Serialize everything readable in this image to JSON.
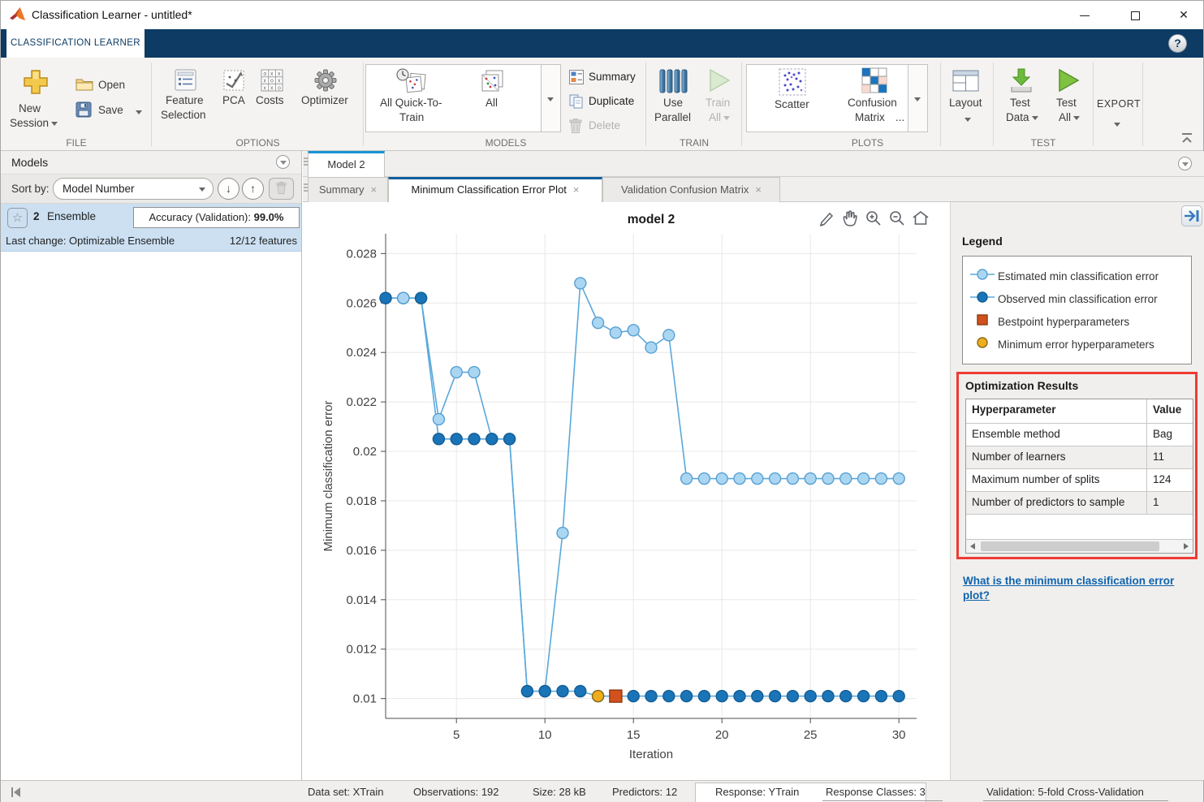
{
  "window": {
    "title": "Classification Learner - untitled*"
  },
  "ribbon": {
    "tab": "CLASSIFICATION LEARNER"
  },
  "icons": {
    "help": "?",
    "star": "☆",
    "sort_descending": "↓",
    "sort_ascending": "↑",
    "close_tab": "×",
    "minimize": "—",
    "maximize": "□",
    "close_window": "✕",
    "matlab_logo": "matlab-membrane-triangles",
    "caret_down": "css-triangle",
    "collapse_left": "|◀ svg",
    "more": "..."
  },
  "colors": {
    "ribbon_navy": "#0d3b63",
    "doc_tab_accent": "#1c94d4",
    "subtab_accent": "#0f5f9e",
    "selection_blue": "#cce0f2",
    "highlight_red": "#ef3b33",
    "link_blue": "#0e63ae"
  },
  "toolbar": {
    "file": {
      "label": "FILE",
      "new_line1": "New",
      "new_line2": "Session",
      "open": "Open",
      "save": "Save"
    },
    "options": {
      "label": "OPTIONS",
      "feature_line1": "Feature",
      "feature_line2": "Selection",
      "pca": "PCA",
      "costs": "Costs",
      "optimizer": "Optimizer"
    },
    "models": {
      "label": "MODELS",
      "quick_line1": "All Quick-To-",
      "quick_line2": "Train",
      "all": "All",
      "summary": "Summary",
      "duplicate": "Duplicate",
      "delete": "Delete"
    },
    "train": {
      "label": "TRAIN",
      "parallel_line1": "Use",
      "parallel_line2": "Parallel",
      "train_line1": "Train",
      "train_line2": "All"
    },
    "plots": {
      "label": "PLOTS",
      "scatter": "Scatter",
      "confusion_line1": "Confusion",
      "confusion_line2": "Matrix",
      "more": "...",
      "layout": "Layout"
    },
    "test": {
      "label": "TEST",
      "data_line1": "Test",
      "data_line2": "Data",
      "all_line1": "Test",
      "all_line2": "All"
    },
    "export": {
      "label": "EXPORT"
    }
  },
  "models_panel": {
    "title": "Models",
    "sort_label": "Sort by:",
    "sort_value": "Model Number",
    "card": {
      "number": "2",
      "type": "Ensemble",
      "accuracy_label": "Accuracy (Validation): ",
      "accuracy_value": "99.0%",
      "last_change": "Last change: Optimizable Ensemble",
      "features": "12/12 features"
    }
  },
  "document": {
    "doc_tab": "Model 2",
    "tabs": [
      {
        "label": "Summary"
      },
      {
        "label": "Minimum Classification Error Plot"
      },
      {
        "label": "Validation Confusion Matrix"
      }
    ]
  },
  "right_panel": {
    "legend_title": "Legend",
    "legend_items": [
      {
        "label": "Estimated min classification error",
        "marker": "circle-line",
        "color": "#abd6f2"
      },
      {
        "label": "Observed min classification error",
        "marker": "circle-line",
        "color": "#1a74b8"
      },
      {
        "label": "Bestpoint hyperparameters",
        "marker": "square",
        "color": "#d3511c"
      },
      {
        "label": "Minimum error hyperparameters",
        "marker": "circle",
        "color": "#eead1e"
      }
    ],
    "optimization": {
      "title": "Optimization Results",
      "columns": [
        "Hyperparameter",
        "Value"
      ],
      "rows": [
        [
          "Ensemble method",
          "Bag"
        ],
        [
          "Number of learners",
          "11"
        ],
        [
          "Maximum number of splits",
          "124"
        ],
        [
          "Number of predictors to sample",
          "1"
        ]
      ]
    },
    "help_link": "What is the minimum classification error plot?"
  },
  "statusbar": {
    "items": [
      "Data set: XTrain",
      "Observations: 192",
      "Size: 28 kB",
      "Predictors: 12",
      "Response: YTrain",
      "Response Classes: 3",
      "Validation: 5-fold Cross-Validation"
    ]
  },
  "chart_data": {
    "type": "line",
    "title": "model 2",
    "xlabel": "Iteration",
    "ylabel": "Minimum classification error",
    "xlim": [
      1,
      31
    ],
    "ylim": [
      0.0092,
      0.0288
    ],
    "xticks": [
      5,
      10,
      15,
      20,
      25,
      30
    ],
    "yticks": [
      0.01,
      0.012,
      0.014,
      0.016,
      0.018,
      0.02,
      0.022,
      0.024,
      0.026,
      0.028
    ],
    "ytick_labels": [
      "0.01",
      "0.012",
      "0.014",
      "0.016",
      "0.018",
      "0.02",
      "0.022",
      "0.024",
      "0.026",
      "0.028"
    ],
    "grid": true,
    "legend_position": "right-panel",
    "line_color": "#58a8db",
    "series": [
      {
        "name": "Estimated min classification error",
        "marker": "circle",
        "marker_fill": "#abd6f2",
        "marker_edge": "#57a0d3",
        "line": true,
        "x": [
          1,
          2,
          3,
          4,
          5,
          6,
          7,
          8,
          9,
          10,
          11,
          12,
          13,
          14,
          15,
          16,
          17,
          18,
          19,
          20,
          21,
          22,
          23,
          24,
          25,
          26,
          27,
          28,
          29,
          30
        ],
        "y": [
          0.0262,
          0.0262,
          0.0262,
          0.0213,
          0.0232,
          0.0232,
          0.0205,
          0.0205,
          0.0103,
          0.0103,
          0.0167,
          0.0268,
          0.0252,
          0.0248,
          0.0249,
          0.0242,
          0.0247,
          0.0189,
          0.0189,
          0.0189,
          0.0189,
          0.0189,
          0.0189,
          0.0189,
          0.0189,
          0.0189,
          0.0189,
          0.0189,
          0.0189,
          0.0189
        ]
      },
      {
        "name": "Observed min classification error",
        "marker": "circle",
        "marker_fill": "#1a74b8",
        "marker_edge": "#135d94",
        "line": true,
        "x": [
          1,
          2,
          3,
          4,
          5,
          6,
          7,
          8,
          9,
          10,
          11,
          12,
          13,
          14,
          15,
          16,
          17,
          18,
          19,
          20,
          21,
          22,
          23,
          24,
          25,
          26,
          27,
          28,
          29,
          30
        ],
        "y": [
          0.0262,
          0.0262,
          0.0262,
          0.0205,
          0.0205,
          0.0205,
          0.0205,
          0.0205,
          0.0103,
          0.0103,
          0.0103,
          0.0103,
          0.0101,
          0.0101,
          0.0101,
          0.0101,
          0.0101,
          0.0101,
          0.0101,
          0.0101,
          0.0101,
          0.0101,
          0.0101,
          0.0101,
          0.0101,
          0.0101,
          0.0101,
          0.0101,
          0.0101,
          0.0101
        ]
      },
      {
        "name": "Minimum error hyperparameters",
        "marker": "circle",
        "marker_fill": "#eead1e",
        "marker_edge": "#8a6a12",
        "line": false,
        "x": [
          13
        ],
        "y": [
          0.0101
        ]
      },
      {
        "name": "Bestpoint hyperparameters",
        "marker": "square",
        "marker_fill": "#d3511c",
        "marker_edge": "#8c3a10",
        "line": false,
        "x": [
          14
        ],
        "y": [
          0.0101
        ]
      }
    ],
    "overlap_top": {
      "series": 0,
      "x": [
        2
      ]
    }
  }
}
